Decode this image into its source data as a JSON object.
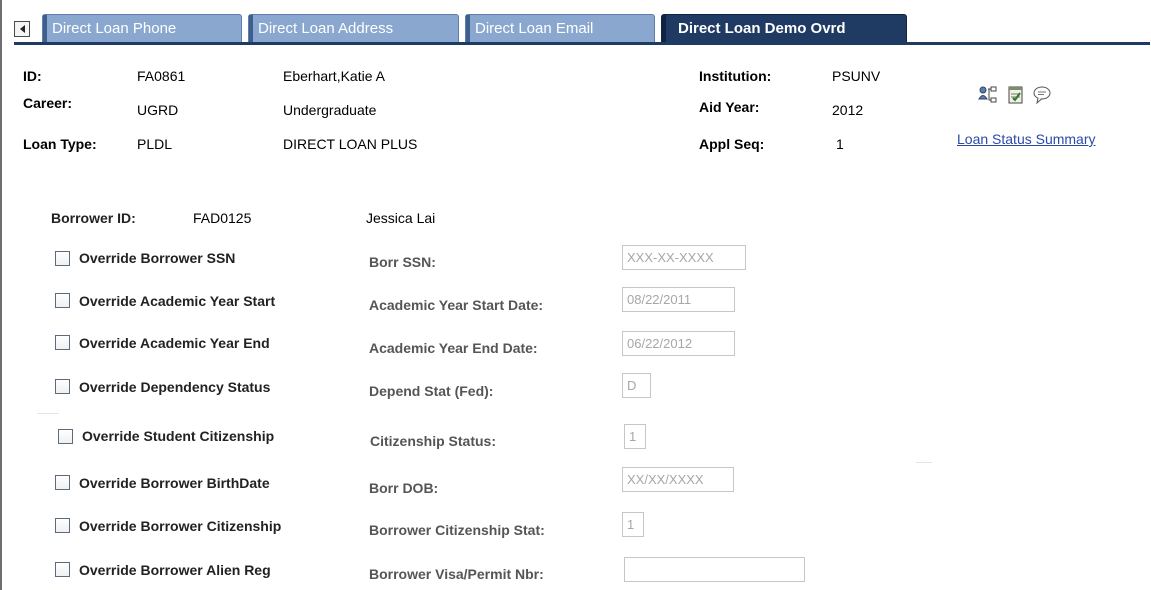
{
  "tabs": [
    {
      "label": "Direct Loan Phone",
      "active": false
    },
    {
      "label": "Direct Loan Address",
      "active": false
    },
    {
      "label": "Direct Loan Email",
      "active": false
    },
    {
      "label": "Direct Loan Demo Ovrd",
      "active": true
    }
  ],
  "header": {
    "id_label": "ID:",
    "id_value": "FA0861",
    "name": "Eberhart,Katie A",
    "career_label": "Career:",
    "career_value": "UGRD",
    "career_desc": "Undergraduate",
    "loan_type_label": "Loan Type:",
    "loan_type_value": "PLDL",
    "loan_type_desc": "DIRECT LOAN PLUS",
    "institution_label": "Institution:",
    "institution_value": "PSUNV",
    "aid_year_label": "Aid Year:",
    "aid_year_value": "2012",
    "appl_seq_label": "Appl Seq:",
    "appl_seq_value": "1",
    "loan_status_link": "Loan Status Summary",
    "icons": [
      "person-tree-icon",
      "notepad-check-icon",
      "speech-bubble-icon"
    ]
  },
  "borrower": {
    "id_label": "Borrower ID:",
    "id_value": "FAD0125",
    "name": "Jessica Lai"
  },
  "overrides": [
    {
      "label": "Override Borrower SSN",
      "field_label": "Borr SSN:",
      "value": "XXX-XX-XXXX",
      "checked": false
    },
    {
      "label": "Override Academic Year Start",
      "field_label": "Academic Year Start Date:",
      "value": "08/22/2011",
      "checked": false
    },
    {
      "label": "Override Academic Year End",
      "field_label": "Academic Year End Date:",
      "value": "06/22/2012",
      "checked": false
    },
    {
      "label": "Override Dependency Status",
      "field_label": "Depend Stat (Fed):",
      "value": "D",
      "checked": false
    },
    {
      "label": "Override Student Citizenship",
      "field_label": "Citizenship Status:",
      "value": "1",
      "checked": false
    },
    {
      "label": "Override Borrower BirthDate",
      "field_label": "Borr DOB:",
      "value": "XX/XX/XXXX",
      "checked": false
    },
    {
      "label": "Override Borrower Citizenship",
      "field_label": "Borrower Citizenship Stat:",
      "value": "1",
      "checked": false
    },
    {
      "label": "Override Borrower Alien Reg",
      "field_label": "Borrower Visa/Permit Nbr:",
      "value": "",
      "checked": false
    }
  ]
}
